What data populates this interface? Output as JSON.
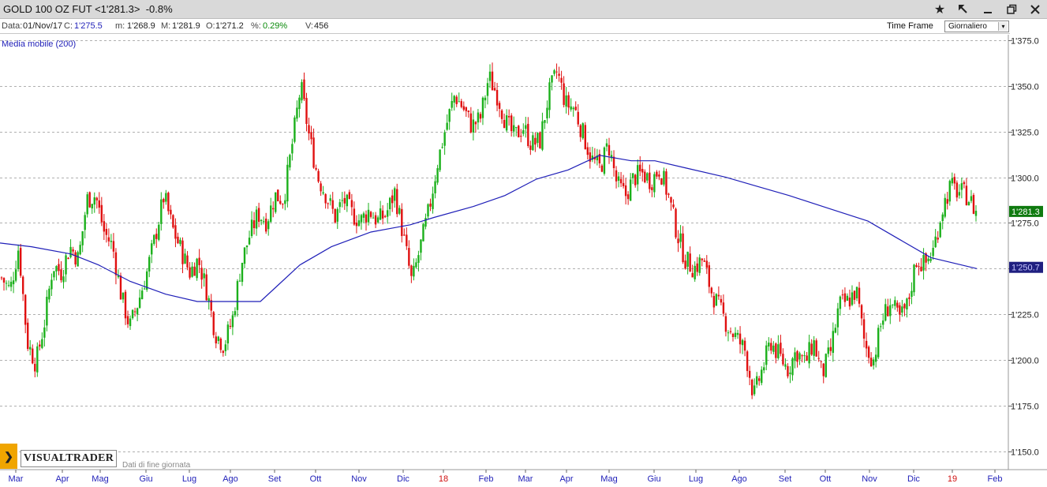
{
  "window": {
    "title": "GOLD 100 OZ FUT <1'281.3>  -0.8%",
    "icons": [
      "star-icon",
      "pin-icon",
      "minimize-icon",
      "restore-icon",
      "close-icon"
    ]
  },
  "infobar": {
    "data_label": "Data:",
    "data_value": "01/Nov/17",
    "close_label": "C:",
    "close_value": "1'275.5",
    "min_label": "m:",
    "min_value": "1'268.9",
    "max_label": "M:",
    "max_value": "1'281.9",
    "open_label": "O:",
    "open_value": "1'271.2",
    "pct_label": "%:",
    "pct_value": "0.29%",
    "vol_label": "V:",
    "vol_value": "456",
    "timeframe_label": "Time Frame",
    "timeframe_value": "Giornaliero"
  },
  "branding": {
    "logo": "VISUALTRADER",
    "footer_note": "Dati di fine giornata"
  },
  "colors": {
    "up": "#1bb01b",
    "down": "#e01010",
    "ma": "#1f1fb8",
    "grid": "#b0b0b0",
    "last_price_bg": "#0f7a0f",
    "ma_price_bg": "#1f1f80"
  },
  "chart_data": {
    "type": "candlestick",
    "title": "GOLD 100 OZ FUT",
    "legend": [
      "Media mobile (200)"
    ],
    "ylim": [
      1140,
      1378
    ],
    "yticks": [
      "1'375.0",
      "1'350.0",
      "1'325.0",
      "1'300.0",
      "1'275.0",
      "1'250.0",
      "1'225.0",
      "1'200.0",
      "1'175.0",
      "1'150.0"
    ],
    "x_labels": [
      {
        "label": "Mar",
        "year": false
      },
      {
        "label": "Apr",
        "year": false
      },
      {
        "label": "Mag",
        "year": false
      },
      {
        "label": "Giu",
        "year": false
      },
      {
        "label": "Lug",
        "year": false
      },
      {
        "label": "Ago",
        "year": false
      },
      {
        "label": "Set",
        "year": false
      },
      {
        "label": "Ott",
        "year": false
      },
      {
        "label": "Nov",
        "year": false
      },
      {
        "label": "Dic",
        "year": false
      },
      {
        "label": "18",
        "year": true
      },
      {
        "label": "Feb",
        "year": false
      },
      {
        "label": "Mar",
        "year": false
      },
      {
        "label": "Apr",
        "year": false
      },
      {
        "label": "Mag",
        "year": false
      },
      {
        "label": "Giu",
        "year": false
      },
      {
        "label": "Lug",
        "year": false
      },
      {
        "label": "Ago",
        "year": false
      },
      {
        "label": "Set",
        "year": false
      },
      {
        "label": "Ott",
        "year": false
      },
      {
        "label": "Nov",
        "year": false
      },
      {
        "label": "Dic",
        "year": false
      },
      {
        "label": "19",
        "year": true
      },
      {
        "label": "Feb",
        "year": false
      }
    ],
    "price_path": [
      1245,
      1238,
      1262,
      1210,
      1198,
      1220,
      1252,
      1248,
      1262,
      1255,
      1288,
      1290,
      1270,
      1262,
      1235,
      1218,
      1232,
      1248,
      1268,
      1290,
      1272,
      1260,
      1248,
      1255,
      1238,
      1215,
      1208,
      1222,
      1252,
      1268,
      1280,
      1276,
      1290,
      1288,
      1318,
      1350,
      1322,
      1300,
      1290,
      1278,
      1288,
      1280,
      1276,
      1282,
      1276,
      1280,
      1292,
      1268,
      1242,
      1262,
      1282,
      1308,
      1328,
      1345,
      1338,
      1328,
      1332,
      1355,
      1345,
      1330,
      1322,
      1328,
      1318,
      1320,
      1345,
      1358,
      1340,
      1338,
      1324,
      1310,
      1305,
      1318,
      1296,
      1290,
      1300,
      1302,
      1298,
      1305,
      1290,
      1270,
      1255,
      1250,
      1255,
      1238,
      1228,
      1218,
      1212,
      1205,
      1180,
      1195,
      1210,
      1202,
      1195,
      1205,
      1198,
      1210,
      1192,
      1205,
      1230,
      1232,
      1238,
      1208,
      1200,
      1222,
      1232,
      1222,
      1230,
      1255,
      1252,
      1260,
      1282,
      1295,
      1292,
      1290,
      1281
    ],
    "ma_200": [
      [
        0,
        1264
      ],
      [
        40,
        1262
      ],
      [
        90,
        1258
      ],
      [
        125,
        1252
      ],
      [
        165,
        1243
      ],
      [
        210,
        1236
      ],
      [
        250,
        1232
      ],
      [
        275,
        1232
      ],
      [
        330,
        1232
      ],
      [
        350,
        1240
      ],
      [
        380,
        1252
      ],
      [
        420,
        1262
      ],
      [
        470,
        1270
      ],
      [
        520,
        1274
      ],
      [
        550,
        1278
      ],
      [
        600,
        1284
      ],
      [
        640,
        1290
      ],
      [
        680,
        1299
      ],
      [
        720,
        1304
      ],
      [
        760,
        1312
      ],
      [
        800,
        1309
      ],
      [
        830,
        1309
      ],
      [
        870,
        1305
      ],
      [
        920,
        1300
      ],
      [
        960,
        1295
      ],
      [
        1000,
        1290
      ],
      [
        1050,
        1283
      ],
      [
        1100,
        1276
      ],
      [
        1140,
        1266
      ],
      [
        1180,
        1256
      ],
      [
        1238,
        1250
      ]
    ],
    "last_price": "1'281.3",
    "ma_price": "1'250.7"
  }
}
